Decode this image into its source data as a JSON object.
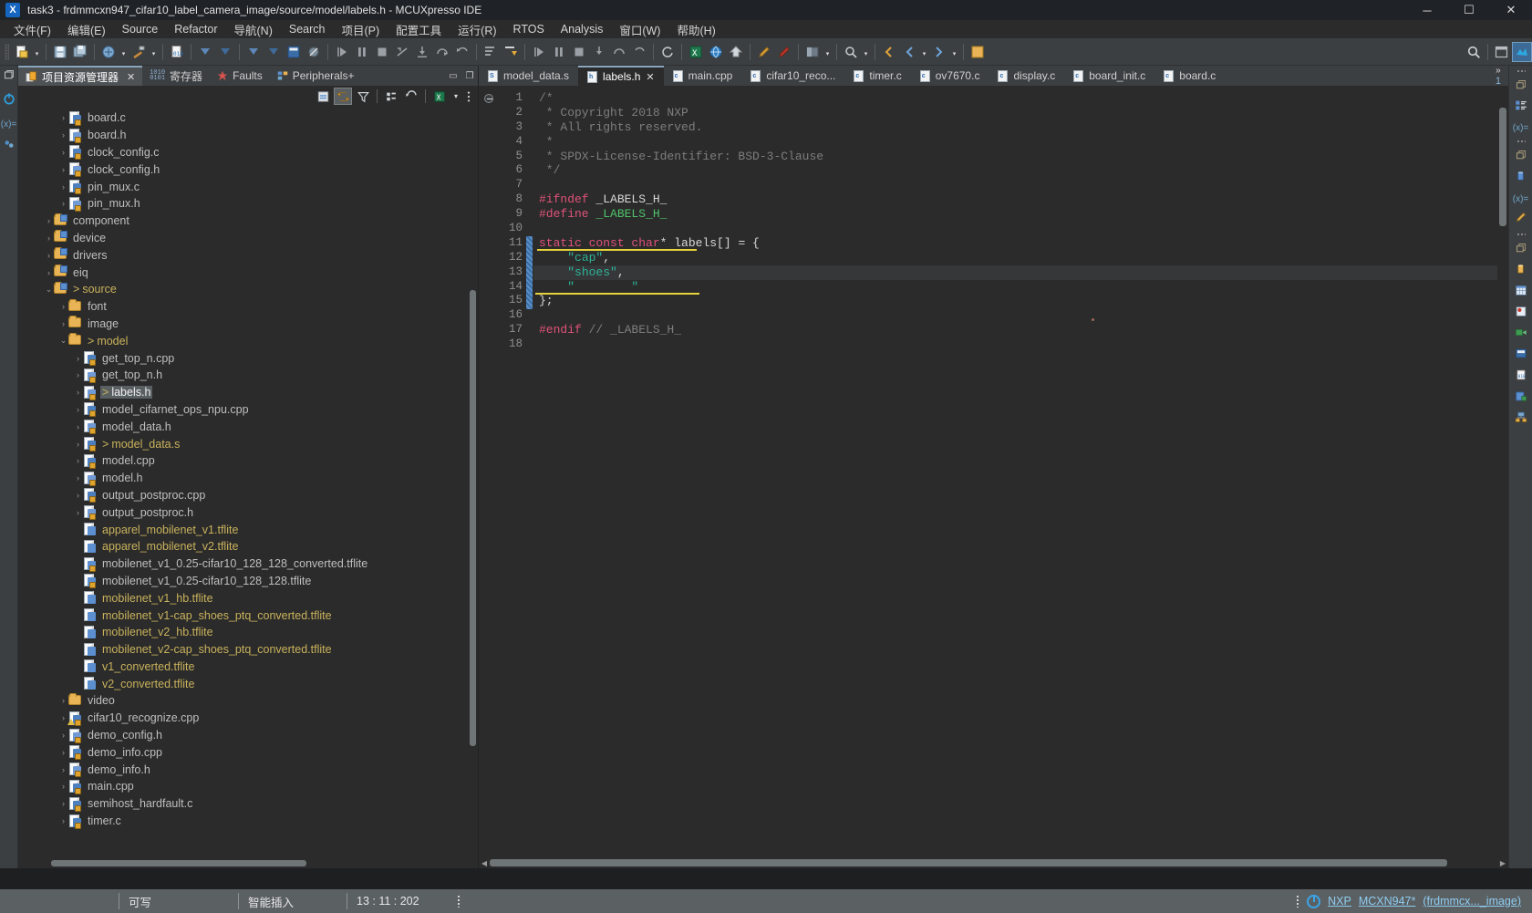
{
  "window": {
    "title": "task3 - frdmmcxn947_cifar10_label_camera_image/source/model/labels.h - MCUXpresso IDE",
    "app_icon": "X",
    "controls": {
      "minimize": "─",
      "maximize": "☐",
      "close": "✕"
    }
  },
  "menubar": [
    "文件(F)",
    "编辑(E)",
    "Source",
    "Refactor",
    "导航(N)",
    "Search",
    "项目(P)",
    "配置工具",
    "运行(R)",
    "RTOS",
    "Analysis",
    "窗口(W)",
    "帮助(H)"
  ],
  "left_panel": {
    "tabs": [
      {
        "label": "项目资源管理器",
        "icon": "project-explorer-icon",
        "active": true,
        "closable": true
      },
      {
        "label": "寄存器",
        "icon": "registers-icon",
        "active": false,
        "closable": false
      },
      {
        "label": "Faults",
        "icon": "faults-icon",
        "active": false,
        "closable": false
      },
      {
        "label": "Peripherals+",
        "icon": "peripherals-icon",
        "active": false,
        "closable": false
      }
    ],
    "panel_buttons": [
      "minimize-view-icon",
      "maximize-view-icon"
    ],
    "toolbar_icons": [
      "collapse-all-icon",
      "link-with-editor-icon",
      "view-filter-icon",
      "grid-view-icon",
      "refresh-icon",
      "excel-export-icon",
      "view-menu-icon"
    ],
    "tree": [
      {
        "indent": 2,
        "chev": "›",
        "icon": "c-file",
        "label": "board.c"
      },
      {
        "indent": 2,
        "chev": "›",
        "icon": "h-file",
        "label": "board.h"
      },
      {
        "indent": 2,
        "chev": "›",
        "icon": "c-file",
        "label": "clock_config.c"
      },
      {
        "indent": 2,
        "chev": "›",
        "icon": "h-file",
        "label": "clock_config.h"
      },
      {
        "indent": 2,
        "chev": "›",
        "icon": "c-file",
        "label": "pin_mux.c"
      },
      {
        "indent": 2,
        "chev": "›",
        "icon": "h-file",
        "label": "pin_mux.h"
      },
      {
        "indent": 1,
        "chev": "›",
        "icon": "folder-src",
        "label": "component"
      },
      {
        "indent": 1,
        "chev": "›",
        "icon": "folder-src",
        "label": "device"
      },
      {
        "indent": 1,
        "chev": "›",
        "icon": "folder-src",
        "label": "drivers"
      },
      {
        "indent": 1,
        "chev": "›",
        "icon": "folder-src",
        "label": "eiq"
      },
      {
        "indent": 1,
        "chev": "⌄",
        "icon": "folder-src",
        "label": "source",
        "dirty": true,
        "yellow": true
      },
      {
        "indent": 2,
        "chev": "›",
        "icon": "folder",
        "label": "font"
      },
      {
        "indent": 2,
        "chev": "›",
        "icon": "folder",
        "label": "image"
      },
      {
        "indent": 2,
        "chev": "⌄",
        "icon": "folder",
        "label": "model",
        "dirty": true,
        "yellow": true
      },
      {
        "indent": 3,
        "chev": "›",
        "icon": "c-file",
        "label": "get_top_n.cpp"
      },
      {
        "indent": 3,
        "chev": "›",
        "icon": "h-file",
        "label": "get_top_n.h"
      },
      {
        "indent": 3,
        "chev": "›",
        "icon": "h-file",
        "label": "labels.h",
        "dirty": true,
        "selected": true
      },
      {
        "indent": 3,
        "chev": "›",
        "icon": "c-file",
        "label": "model_cifarnet_ops_npu.cpp"
      },
      {
        "indent": 3,
        "chev": "›",
        "icon": "h-file",
        "label": "model_data.h"
      },
      {
        "indent": 3,
        "chev": "›",
        "icon": "c-file",
        "label": "model_data.s",
        "dirty": true,
        "yellow": true
      },
      {
        "indent": 3,
        "chev": "›",
        "icon": "c-file",
        "label": "model.cpp"
      },
      {
        "indent": 3,
        "chev": "›",
        "icon": "h-file",
        "label": "model.h"
      },
      {
        "indent": 3,
        "chev": "›",
        "icon": "c-file",
        "label": "output_postproc.cpp"
      },
      {
        "indent": 3,
        "chev": "›",
        "icon": "h-file",
        "label": "output_postproc.h"
      },
      {
        "indent": 3,
        "chev": "",
        "icon": "q-file",
        "label": "apparel_mobilenet_v1.tflite",
        "yellow": true
      },
      {
        "indent": 3,
        "chev": "",
        "icon": "q-file",
        "label": "apparel_mobilenet_v2.tflite",
        "yellow": true
      },
      {
        "indent": 3,
        "chev": "",
        "icon": "q-file-lock",
        "label": "mobilenet_v1_0.25-cifar10_128_128_converted.tflite"
      },
      {
        "indent": 3,
        "chev": "",
        "icon": "q-file-lock",
        "label": "mobilenet_v1_0.25-cifar10_128_128.tflite"
      },
      {
        "indent": 3,
        "chev": "",
        "icon": "q-file",
        "label": "mobilenet_v1_hb.tflite",
        "yellow": true
      },
      {
        "indent": 3,
        "chev": "",
        "icon": "q-file",
        "label": "mobilenet_v1-cap_shoes_ptq_converted.tflite",
        "yellow": true
      },
      {
        "indent": 3,
        "chev": "",
        "icon": "q-file",
        "label": "mobilenet_v2_hb.tflite",
        "yellow": true
      },
      {
        "indent": 3,
        "chev": "",
        "icon": "q-file",
        "label": "mobilenet_v2-cap_shoes_ptq_converted.tflite",
        "yellow": true
      },
      {
        "indent": 3,
        "chev": "",
        "icon": "q-file",
        "label": "v1_converted.tflite",
        "yellow": true
      },
      {
        "indent": 3,
        "chev": "",
        "icon": "q-file",
        "label": "v2_converted.tflite",
        "yellow": true
      },
      {
        "indent": 2,
        "chev": "›",
        "icon": "folder",
        "label": "video"
      },
      {
        "indent": 2,
        "chev": "›",
        "icon": "c-file-warn",
        "label": "cifar10_recognize.cpp"
      },
      {
        "indent": 2,
        "chev": "›",
        "icon": "h-file",
        "label": "demo_config.h"
      },
      {
        "indent": 2,
        "chev": "›",
        "icon": "c-file",
        "label": "demo_info.cpp"
      },
      {
        "indent": 2,
        "chev": "›",
        "icon": "h-file",
        "label": "demo_info.h"
      },
      {
        "indent": 2,
        "chev": "›",
        "icon": "c-file",
        "label": "main.cpp"
      },
      {
        "indent": 2,
        "chev": "›",
        "icon": "c-file",
        "label": "semihost_hardfault.c"
      },
      {
        "indent": 2,
        "chev": "›",
        "icon": "c-file",
        "label": "timer.c"
      }
    ]
  },
  "editor": {
    "tabs": [
      {
        "label": "model_data.s",
        "kind": "S",
        "active": false,
        "closable": false
      },
      {
        "label": "labels.h",
        "kind": "h",
        "active": true,
        "closable": true
      },
      {
        "label": "main.cpp",
        "kind": "c",
        "active": false,
        "closable": false
      },
      {
        "label": "cifar10_reco...",
        "kind": "c",
        "active": false,
        "closable": false
      },
      {
        "label": "timer.c",
        "kind": "c",
        "active": false,
        "closable": false
      },
      {
        "label": "ov7670.c",
        "kind": "c",
        "active": false,
        "closable": false
      },
      {
        "label": "display.c",
        "kind": "c",
        "active": false,
        "closable": false
      },
      {
        "label": "board_init.c",
        "kind": "c",
        "active": false,
        "closable": false
      },
      {
        "label": "board.c",
        "kind": "c",
        "active": false,
        "closable": false
      }
    ],
    "overflow": {
      "chevrons": "»",
      "count": "1"
    },
    "line_numbers": [
      "1",
      "2",
      "3",
      "4",
      "5",
      "6",
      "7",
      "8",
      "9",
      "10",
      "11",
      "12",
      "13",
      "14",
      "15",
      "16",
      "17",
      "18"
    ],
    "code_lines": [
      {
        "n": 1,
        "fold": true,
        "segments": [
          {
            "t": "/*",
            "c": "cmt"
          }
        ]
      },
      {
        "n": 2,
        "segments": [
          {
            "t": " * Copyright 2018 NXP",
            "c": "cmt"
          }
        ]
      },
      {
        "n": 3,
        "segments": [
          {
            "t": " * All rights reserved.",
            "c": "cmt"
          }
        ]
      },
      {
        "n": 4,
        "segments": [
          {
            "t": " *",
            "c": "cmt"
          }
        ]
      },
      {
        "n": 5,
        "segments": [
          {
            "t": " * SPDX-License-Identifier: BSD-3-Clause",
            "c": "cmt"
          }
        ]
      },
      {
        "n": 6,
        "segments": [
          {
            "t": " */",
            "c": "cmt"
          }
        ]
      },
      {
        "n": 7,
        "segments": [
          {
            "t": "",
            "c": "plain"
          }
        ]
      },
      {
        "n": 8,
        "segments": [
          {
            "t": "#ifndef",
            "c": "pre"
          },
          {
            "t": " _LABELS_H_",
            "c": "plain"
          }
        ]
      },
      {
        "n": 9,
        "segments": [
          {
            "t": "#define",
            "c": "pre"
          },
          {
            "t": " ",
            "c": "plain"
          },
          {
            "t": "_LABELS_H_",
            "c": "grn"
          }
        ]
      },
      {
        "n": 10,
        "segments": [
          {
            "t": "",
            "c": "plain"
          }
        ]
      },
      {
        "n": 11,
        "marker": true,
        "segments": [
          {
            "t": "static const char",
            "c": "kw"
          },
          {
            "t": "* labels[] = {",
            "c": "plain"
          }
        ]
      },
      {
        "n": 12,
        "marker": true,
        "segments": [
          {
            "t": "    ",
            "c": "plain"
          },
          {
            "t": "\"cap\"",
            "c": "str"
          },
          {
            "t": ",",
            "c": "plain"
          }
        ]
      },
      {
        "n": 13,
        "marker": true,
        "current": true,
        "segments": [
          {
            "t": "    ",
            "c": "plain"
          },
          {
            "t": "\"shoes\"",
            "c": "str"
          },
          {
            "t": ",",
            "c": "plain"
          }
        ]
      },
      {
        "n": 14,
        "marker": true,
        "segments": [
          {
            "t": "    ",
            "c": "plain"
          },
          {
            "t": "\"        \"",
            "c": "str"
          }
        ]
      },
      {
        "n": 15,
        "marker": true,
        "segments": [
          {
            "t": "};",
            "c": "plain"
          }
        ]
      },
      {
        "n": 16,
        "segments": [
          {
            "t": "",
            "c": "plain"
          }
        ]
      },
      {
        "n": 17,
        "segments": [
          {
            "t": "#endif",
            "c": "pre"
          },
          {
            "t": " // _LABELS_H_",
            "c": "cmt"
          }
        ]
      },
      {
        "n": 18,
        "segments": [
          {
            "t": "",
            "c": "plain"
          }
        ]
      }
    ]
  },
  "statusbar": {
    "writable": "可写",
    "insert_mode": "智能插入",
    "position": "13 : 11 : 202",
    "target_prefix": "NXP",
    "target_device": "MCXN947*",
    "target_project": "(frdmmcx..._image)"
  },
  "colors": {
    "accent": "#8aa7c0",
    "link": "#8ecdf0",
    "string": "#2eb398",
    "keyword": "#e0527a",
    "comment": "#7d7d7d",
    "green": "#4fc36a",
    "yellow_underline": "#e6d23a",
    "tree_yellow": "#c9b25c"
  }
}
